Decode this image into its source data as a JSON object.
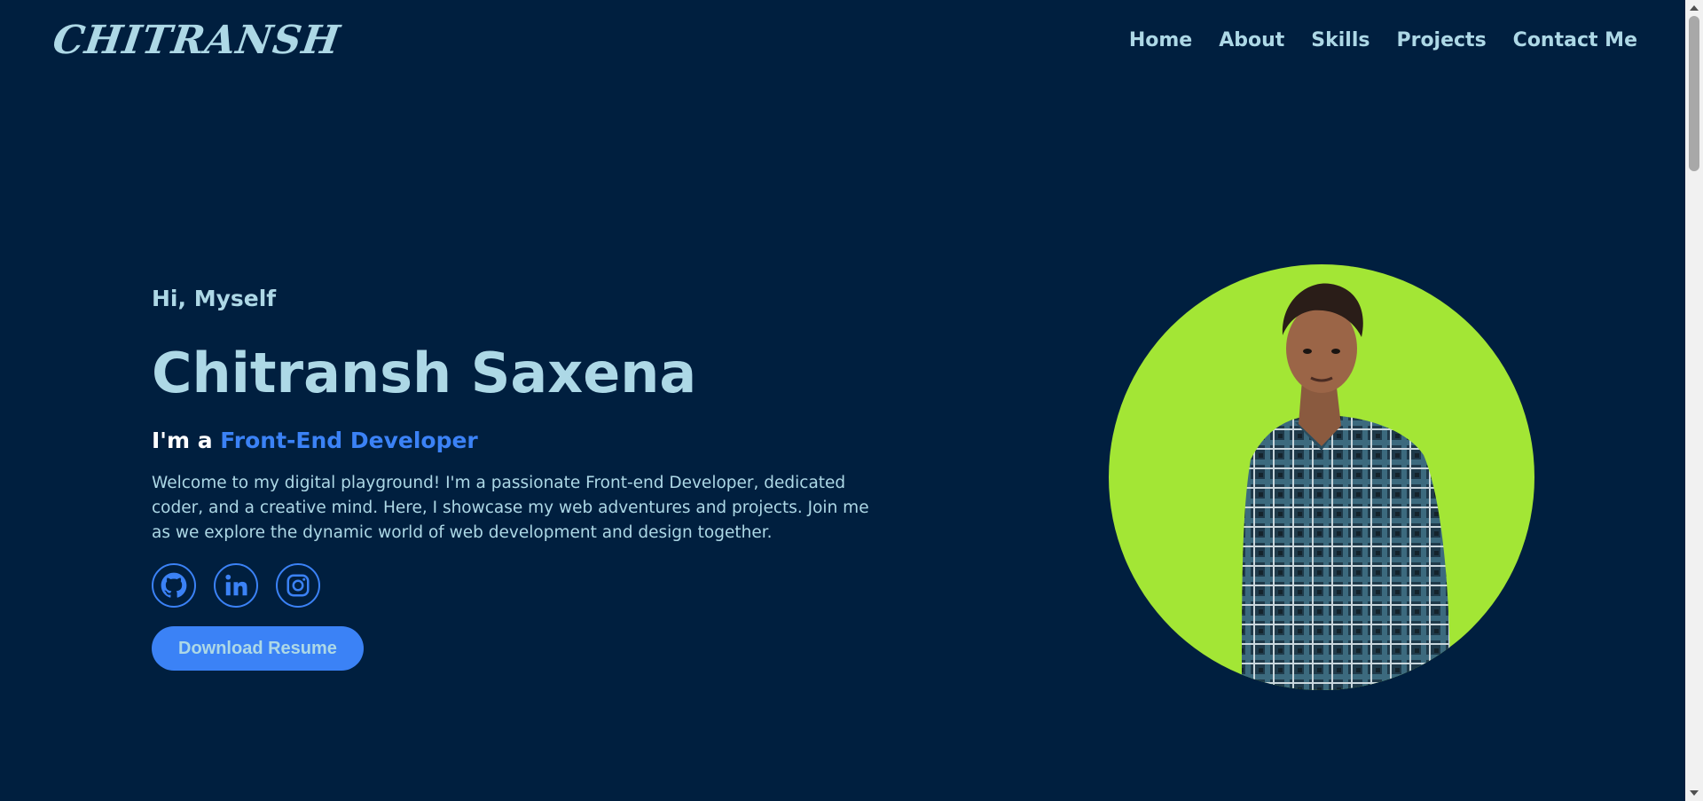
{
  "header": {
    "logo": "CHITRANSH",
    "nav": [
      "Home",
      "About",
      "Skills",
      "Projects",
      "Contact Me"
    ]
  },
  "hero": {
    "greeting": "Hi, Myself",
    "name": "Chitransh Saxena",
    "role_prefix": "I'm a ",
    "role_title": "Front-End Developer",
    "intro": "Welcome to my digital playground! I'm a passionate Front-end Developer, dedicated coder, and a creative mind. Here, I showcase my web adventures and projects. Join me as we explore the dynamic world of web development and design together.",
    "socials": [
      {
        "icon": "github-icon"
      },
      {
        "icon": "linkedin-icon"
      },
      {
        "icon": "instagram-icon"
      }
    ],
    "download_label": "Download Resume"
  },
  "profile": {
    "image": "profile-photo",
    "background_color": "#a3e635"
  },
  "colors": {
    "background": "#001f3f",
    "text": "#add8e6",
    "accent": "#3b82f6"
  }
}
